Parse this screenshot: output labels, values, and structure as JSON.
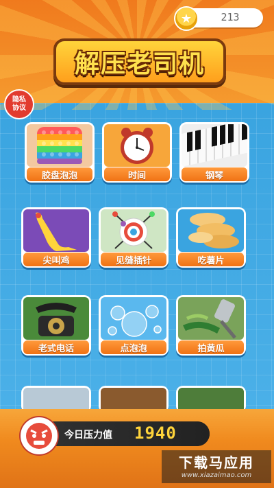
{
  "header": {
    "coin_count": "213",
    "logo_text": "解压老司机",
    "privacy_label_line1": "隐私",
    "privacy_label_line2": "协议"
  },
  "games": [
    {
      "label": "胶盘泡泡",
      "icon": "pop-it-icon"
    },
    {
      "label": "时间",
      "icon": "alarm-clock-icon"
    },
    {
      "label": "钢琴",
      "icon": "piano-icon"
    },
    {
      "label": "尖叫鸡",
      "icon": "rubber-chicken-icon"
    },
    {
      "label": "见缝插针",
      "icon": "pin-target-icon"
    },
    {
      "label": "吃薯片",
      "icon": "potato-chips-icon"
    },
    {
      "label": "老式电话",
      "icon": "rotary-phone-icon"
    },
    {
      "label": "点泡泡",
      "icon": "bubbles-icon"
    },
    {
      "label": "拍黄瓜",
      "icon": "cucumber-icon"
    }
  ],
  "footer": {
    "pressure_label": "今日压力值",
    "pressure_value": "1940",
    "watermark_title": "下载马应用",
    "watermark_url": "www.xiazaimao.com"
  },
  "colors": {
    "accent": "#f07214",
    "background_blue": "#3aa4e0",
    "value_yellow": "#ffd43b"
  }
}
